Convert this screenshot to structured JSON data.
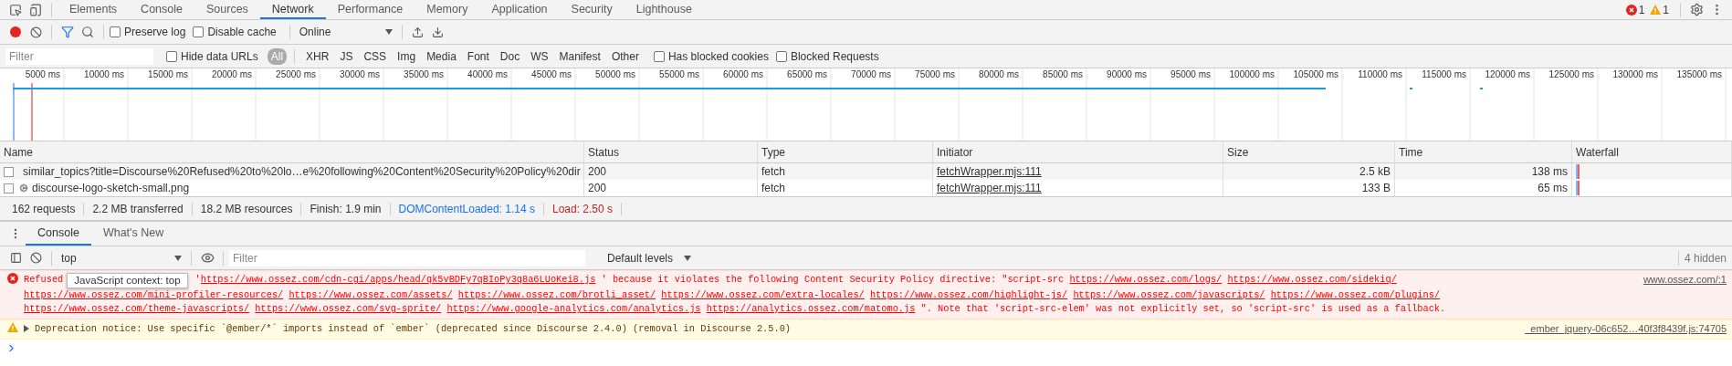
{
  "top_bar": {
    "tabs": [
      {
        "label": "Elements",
        "selected": false
      },
      {
        "label": "Console",
        "selected": false
      },
      {
        "label": "Sources",
        "selected": false
      },
      {
        "label": "Network",
        "selected": true
      },
      {
        "label": "Performance",
        "selected": false
      },
      {
        "label": "Memory",
        "selected": false
      },
      {
        "label": "Application",
        "selected": false
      },
      {
        "label": "Security",
        "selected": false
      },
      {
        "label": "Lighthouse",
        "selected": false
      }
    ],
    "error_count": "1",
    "warning_count": "1"
  },
  "network_toolbar": {
    "recording": true,
    "filter_active": true,
    "checkboxes": [
      {
        "label": "Preserve log",
        "checked": false
      },
      {
        "label": "Disable cache",
        "checked": false
      }
    ],
    "throttling": "Online"
  },
  "filter_bar": {
    "placeholder": "Filter",
    "hide_data_urls": {
      "label": "Hide data URLs",
      "checked": false
    },
    "types": [
      {
        "label": "All",
        "selected": true
      },
      {
        "label": "XHR",
        "selected": false
      },
      {
        "label": "JS",
        "selected": false
      },
      {
        "label": "CSS",
        "selected": false
      },
      {
        "label": "Img",
        "selected": false
      },
      {
        "label": "Media",
        "selected": false
      },
      {
        "label": "Font",
        "selected": false
      },
      {
        "label": "Doc",
        "selected": false
      },
      {
        "label": "WS",
        "selected": false
      },
      {
        "label": "Manifest",
        "selected": false
      },
      {
        "label": "Other",
        "selected": false
      }
    ],
    "extra_checkboxes": [
      {
        "label": "Has blocked cookies",
        "checked": false
      },
      {
        "label": "Blocked Requests",
        "checked": false
      }
    ]
  },
  "overview": {
    "ticks": [
      "5000 ms",
      "10000 ms",
      "15000 ms",
      "20000 ms",
      "25000 ms",
      "30000 ms",
      "35000 ms",
      "40000 ms",
      "45000 ms",
      "50000 ms",
      "55000 ms",
      "60000 ms",
      "65000 ms",
      "70000 ms",
      "75000 ms",
      "80000 ms",
      "85000 ms",
      "90000 ms",
      "95000 ms",
      "100000 ms",
      "105000 ms",
      "110000 ms",
      "115000 ms",
      "120000 ms",
      "125000 ms",
      "130000 ms",
      "135000 ms"
    ]
  },
  "table": {
    "columns": [
      "Name",
      "Status",
      "Type",
      "Initiator",
      "Size",
      "Time",
      "Waterfall"
    ],
    "rows": [
      {
        "name": "similar_topics?title=Discourse%20Refused%20to%20lo…e%20following%20Content%20Security%20Policy%20dir",
        "status": "200",
        "type": "fetch",
        "initiator": "fetchWrapper.mjs:111",
        "size": "2.5 kB",
        "time": "138 ms"
      },
      {
        "name": "discourse-logo-sketch-small.png",
        "status": "200",
        "type": "fetch",
        "initiator": "fetchWrapper.mjs:111",
        "size": "133 B",
        "time": "65 ms"
      }
    ]
  },
  "summary": [
    {
      "text": "162 requests",
      "kind": "plain"
    },
    {
      "text": "2.2 MB transferred",
      "kind": "plain"
    },
    {
      "text": "18.2 MB resources",
      "kind": "plain"
    },
    {
      "text": "Finish: 1.9 min",
      "kind": "plain"
    },
    {
      "text": "DOMContentLoaded: 1.14 s",
      "kind": "dom"
    },
    {
      "text": "Load: 2.50 s",
      "kind": "load"
    }
  ],
  "drawer_tabs": [
    {
      "label": "Console",
      "selected": true
    },
    {
      "label": "What's New",
      "selected": false
    }
  ],
  "console_toolbar": {
    "context": "top",
    "filter_placeholder": "Filter",
    "levels": "Default levels",
    "hidden": "4 hidden"
  },
  "messages": [
    {
      "kind": "error",
      "tooltip": "JavaScript context: top",
      "source": "www.ossez.com/:1",
      "segments": [
        {
          "kind": "text",
          "text": "Refused"
        },
        {
          "kind": "text",
          "text": "'"
        },
        {
          "kind": "link",
          "text": "https://www.ossez.com/cdn-cgi/apps/head/qk5vBDFy7qBIoPy3q8a6LUoKei8.js"
        },
        {
          "kind": "text",
          "text": "' because it violates the following Content Security Policy directive: \"script-src "
        },
        {
          "kind": "link",
          "text": "https://www.ossez.com/logs/"
        },
        {
          "kind": "link",
          "text": "https://www.ossez.com/sidekiq/"
        },
        {
          "kind": "link",
          "text": "https://www.ossez.com/mini-profiler-resources/"
        },
        {
          "kind": "link",
          "text": "https://www.ossez.com/assets/"
        },
        {
          "kind": "link",
          "text": "https://www.ossez.com/brotli_asset/"
        },
        {
          "kind": "link",
          "text": "https://www.ossez.com/extra-locales/"
        },
        {
          "kind": "link",
          "text": "https://www.ossez.com/highlight-js/"
        },
        {
          "kind": "link",
          "text": "https://www.ossez.com/javascripts/"
        },
        {
          "kind": "link",
          "text": "https://www.ossez.com/plugins/"
        },
        {
          "kind": "link",
          "text": "https://www.ossez.com/theme-javascripts/"
        },
        {
          "kind": "link",
          "text": "https://www.ossez.com/svg-sprite/"
        },
        {
          "kind": "link",
          "text": "https://www.google-analytics.com/analytics.js"
        },
        {
          "kind": "link",
          "text": "https://analytics.ossez.com/matomo.js"
        },
        {
          "kind": "text",
          "text": "\". Note that 'script-src-elem' was not explicitly set, so 'script-src' is used as a fallback."
        }
      ]
    },
    {
      "kind": "warning",
      "source": "_ember_jquery-06c652…40f3f8439f.js:74705",
      "segments": [
        {
          "kind": "text",
          "text": "Deprecation notice: Use specific `@ember/*` imports instead of `ember` (deprecated since Discourse 2.4.0) (removal in Discourse 2.5.0)"
        }
      ]
    }
  ]
}
